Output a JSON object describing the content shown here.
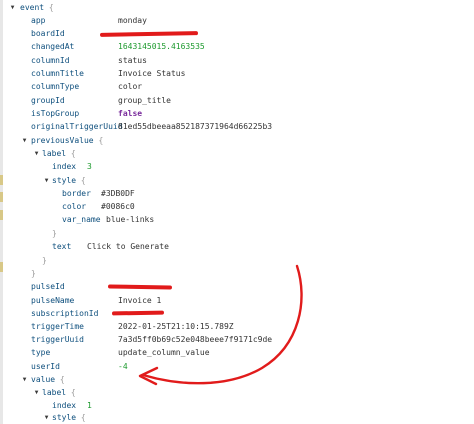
{
  "tree": {
    "root_key": "event",
    "open_brace": "{",
    "close_brace": "}",
    "fields": {
      "app": {
        "key": "app",
        "value": "monday"
      },
      "boardId": {
        "key": "boardId"
      },
      "changedAt": {
        "key": "changedAt",
        "value": "1643145015.4163535"
      },
      "columnId": {
        "key": "columnId",
        "value": "status"
      },
      "columnTitle": {
        "key": "columnTitle",
        "value": "Invoice Status"
      },
      "columnType": {
        "key": "columnType",
        "value": "color"
      },
      "groupId": {
        "key": "groupId",
        "value": "group_title"
      },
      "isTopGroup": {
        "key": "isTopGroup",
        "value": "false"
      },
      "originalTriggerUuid": {
        "key": "originalTriggerUuid",
        "value": "81ed55dbeeaa852187371964d66225b3"
      },
      "previousValue": {
        "key": "previousValue",
        "label": {
          "key": "label",
          "index": {
            "key": "index",
            "value": "3"
          },
          "style": {
            "key": "style",
            "border": {
              "key": "border",
              "value": "#3DB0DF"
            },
            "color": {
              "key": "color",
              "value": "#0086c0"
            },
            "var_name": {
              "key": "var_name",
              "value": "blue-links"
            }
          },
          "text": {
            "key": "text",
            "value": "Click to Generate"
          }
        }
      },
      "pulseId": {
        "key": "pulseId"
      },
      "pulseName": {
        "key": "pulseName",
        "value": "Invoice 1"
      },
      "subscriptionId": {
        "key": "subscriptionId"
      },
      "triggerTime": {
        "key": "triggerTime",
        "value": "2022-01-25T21:10:15.789Z"
      },
      "triggerUuid": {
        "key": "triggerUuid",
        "value": "7a3d5ff0b69c52e048beee7f9171c9de"
      },
      "type": {
        "key": "type",
        "value": "update_column_value"
      },
      "userId": {
        "key": "userId",
        "value": "-4"
      },
      "value": {
        "key": "value",
        "label": {
          "key": "label",
          "index": {
            "key": "index",
            "value": "1"
          },
          "style": {
            "key": "style"
          }
        }
      }
    }
  },
  "colors": {
    "key": "#0e4f7d",
    "string": "#333333",
    "number": "#1d9a2e",
    "boolean": "#7a2c9c",
    "annotation": "#e11b1b"
  },
  "icons": {
    "toggle": "triangle-down-icon"
  }
}
